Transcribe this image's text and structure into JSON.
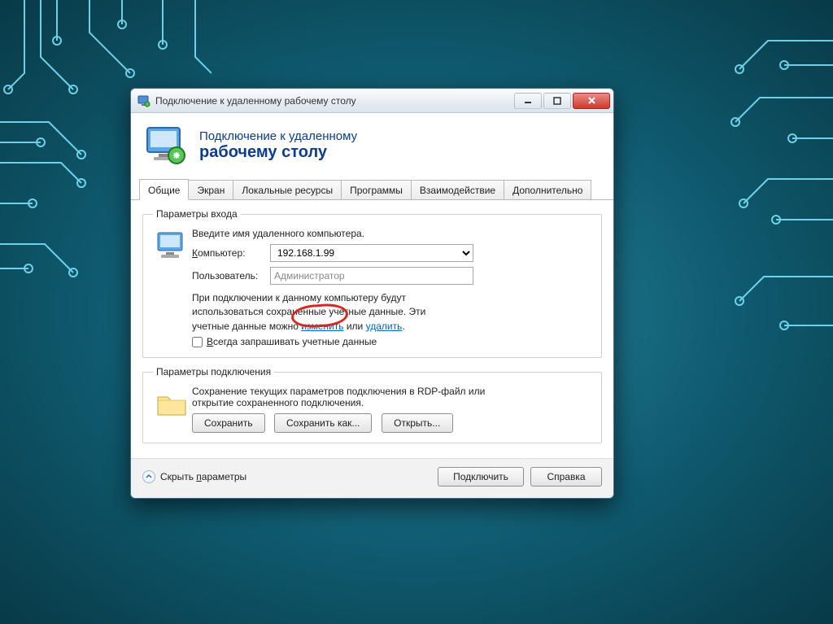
{
  "titlebar": {
    "title": "Подключение к удаленному рабочему столу"
  },
  "header": {
    "line1": "Подключение к удаленному",
    "line2": "рабочему столу"
  },
  "tabs": {
    "general": "Общие",
    "display": "Экран",
    "local": "Локальные ресурсы",
    "programs": "Программы",
    "experience": "Взаимодействие",
    "advanced": "Дополнительно"
  },
  "login": {
    "legend": "Параметры входа",
    "prompt": "Введите имя удаленного компьютера.",
    "computer_label_pre": "К",
    "computer_label_rest": "омпьютер:",
    "computer_value": "192.168.1.99",
    "user_label": "Пользователь:",
    "user_placeholder": "Администратор",
    "cred_line1": "При подключении к данному компьютеру будут",
    "cred_line2a": "использоваться сохраненные учетные данные. Эти",
    "cred_line3a": "учетные данные можно ",
    "cred_link_change": "изменить",
    "cred_line3b": " или ",
    "cred_link_delete": "удалить",
    "cred_line3c": ".",
    "always_ask_pre": "В",
    "always_ask_rest": "сегда запрашивать учетные данные"
  },
  "conn": {
    "legend": "Параметры подключения",
    "desc1": "Сохранение текущих параметров подключения в RDP-файл или",
    "desc2": "открытие сохраненного подключения.",
    "save": "Сохранить",
    "save_as": "Сохранить как...",
    "open": "Открыть..."
  },
  "footer": {
    "hide_pre": "Скрыть ",
    "hide_u": "п",
    "hide_rest": "араметры",
    "connect": "Подключить",
    "help": "Справка"
  }
}
